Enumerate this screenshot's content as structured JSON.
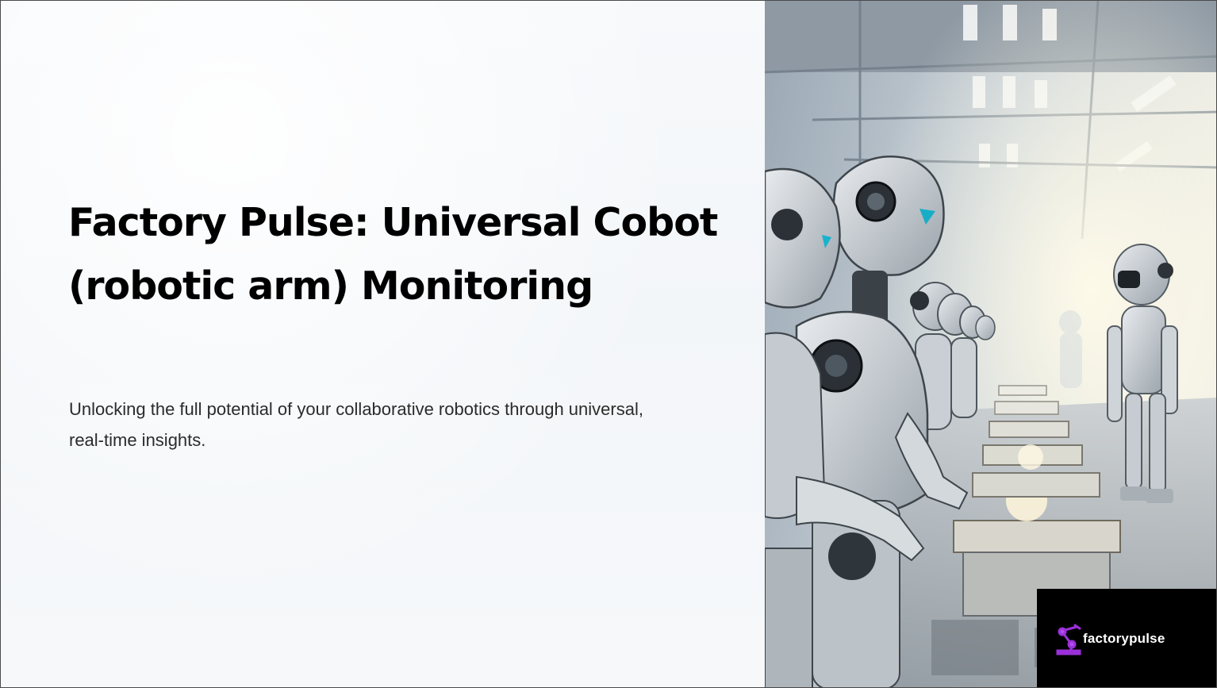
{
  "slide": {
    "title": "Factory Pulse: Universal Cobot (robotic arm) Monitoring",
    "subtitle": "Unlocking the full potential of your collaborative robotics through universal, real-time insights."
  },
  "logo": {
    "text": "factorypulse",
    "icon": "robotic-arm-icon",
    "icon_color": "#9b30d9"
  },
  "image": {
    "subject": "factory-robots-image"
  },
  "colors": {
    "title": "#000000",
    "subtitle": "#2b2b2b",
    "logo_background": "#000000"
  }
}
